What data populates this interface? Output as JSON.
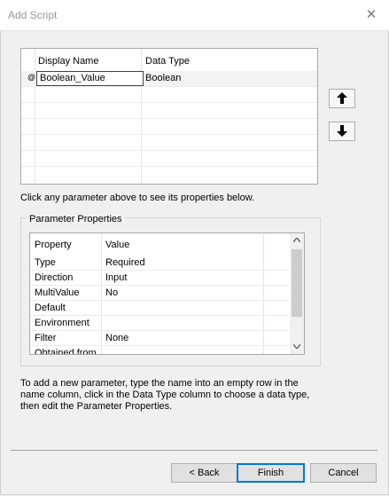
{
  "window": {
    "title": "Add Script",
    "close_glyph": "✕"
  },
  "parameters": {
    "columns": [
      "Display Name",
      "Data Type"
    ],
    "rows": [
      {
        "marker": "@",
        "display_name": "Boolean_Value",
        "data_type": "Boolean"
      }
    ],
    "move_up_icon": "arrow-up-icon",
    "move_down_icon": "arrow-down-icon"
  },
  "hint": "Click any parameter above to see its properties below.",
  "parameter_properties": {
    "group_label": "Parameter Properties",
    "columns": [
      "Property",
      "Value"
    ],
    "rows": [
      {
        "property": "Type",
        "value": "Required"
      },
      {
        "property": "Direction",
        "value": "Input"
      },
      {
        "property": "MultiValue",
        "value": "No"
      },
      {
        "property": "Default",
        "value": ""
      },
      {
        "property": "Environment",
        "value": ""
      },
      {
        "property": "Filter",
        "value": "None"
      },
      {
        "property": "Obtained from",
        "value": ""
      }
    ]
  },
  "instructions": "To add a new parameter, type the name into an empty row in the name column, click in the Data Type column to choose a data type, then edit the Parameter Properties.",
  "buttons": {
    "back": "< Back",
    "finish": "Finish",
    "cancel": "Cancel"
  }
}
